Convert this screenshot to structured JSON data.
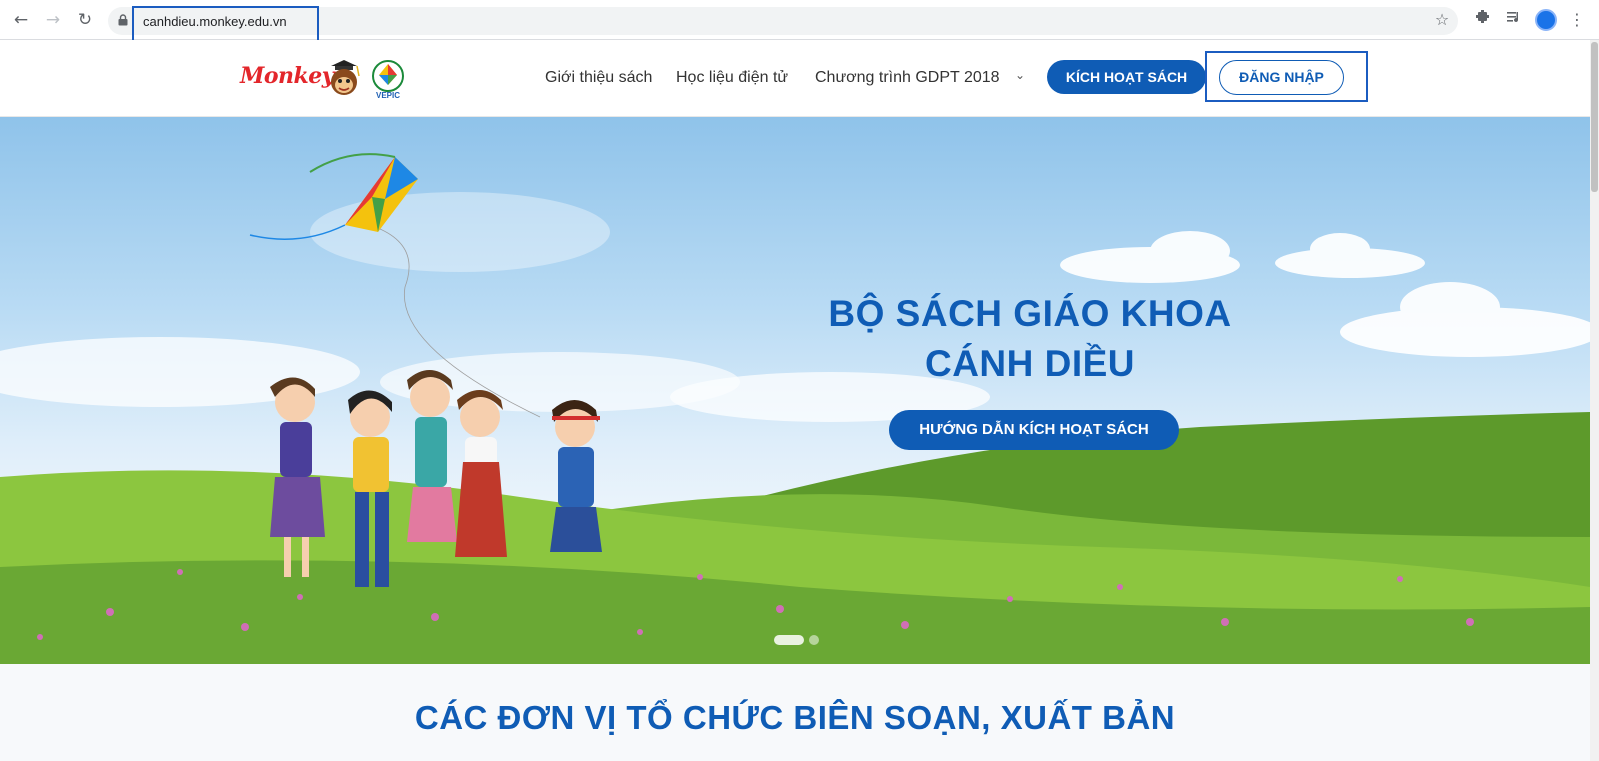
{
  "browser": {
    "url": "canhdieu.monkey.edu.vn",
    "icons": [
      "back-icon",
      "forward-icon",
      "reload-icon",
      "lock-icon",
      "star-icon",
      "extensions-icon",
      "media-icon",
      "profile-icon",
      "menu-icon"
    ]
  },
  "header": {
    "logo_text": "Monkey",
    "logo_mark": "VEPIC",
    "nav": [
      "Giới thiệu sách",
      "Học liệu điện tử",
      "Chương trình GDPT 2018"
    ],
    "activate_label": "KÍCH HOẠT SÁCH",
    "login_label": "ĐĂNG NHẬP"
  },
  "hero": {
    "title_line1": "BỘ SÁCH GIÁO KHOA",
    "title_line2": "CÁNH DIỀU",
    "guide_label": "HƯỚNG DẪN KÍCH HOẠT SÁCH",
    "slide_count": 2,
    "active_slide": 1
  },
  "section": {
    "title": "CÁC ĐƠN VỊ TỔ CHỨC BIÊN SOẠN, XUẤT BẢN"
  },
  "colors": {
    "brand_blue": "#0f5cb5",
    "monkey_red": "#e3262b",
    "highlight_box": "#1b5cc0"
  }
}
